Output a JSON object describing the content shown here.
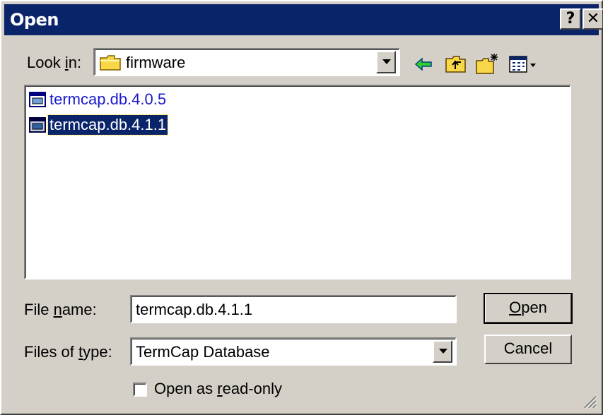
{
  "title": "Open",
  "title_buttons": {
    "help": "?",
    "close": "✕"
  },
  "lookin": {
    "label_pre": "Look ",
    "label_acc": "i",
    "label_post": "n:",
    "value": "firmware",
    "icon": "folder-icon"
  },
  "toolbar": {
    "icons": [
      "back-arrow-icon",
      "up-one-level-icon",
      "create-new-folder-icon",
      "view-menu-icon"
    ]
  },
  "files": [
    {
      "name": "termcap.db.4.0.5",
      "icon": "database-file-icon",
      "selected": false
    },
    {
      "name": "termcap.db.4.1.1",
      "icon": "database-file-icon",
      "selected": true
    }
  ],
  "filename": {
    "label_pre": "File ",
    "label_acc": "n",
    "label_post": "ame:",
    "value": "termcap.db.4.1.1"
  },
  "filetype": {
    "label_pre": "Files of ",
    "label_acc": "t",
    "label_post": "ype:",
    "value": "TermCap Database"
  },
  "open_button": {
    "acc": "O",
    "rest": "pen"
  },
  "cancel_button": "Cancel",
  "readonly": {
    "label_pre": "Open as ",
    "label_acc": "r",
    "label_post": "ead-only",
    "checked": false
  },
  "colors": {
    "titlebar": "#0a246a",
    "face": "#d4d0c8",
    "selection": "#0a246a",
    "link": "#1a1acc"
  }
}
